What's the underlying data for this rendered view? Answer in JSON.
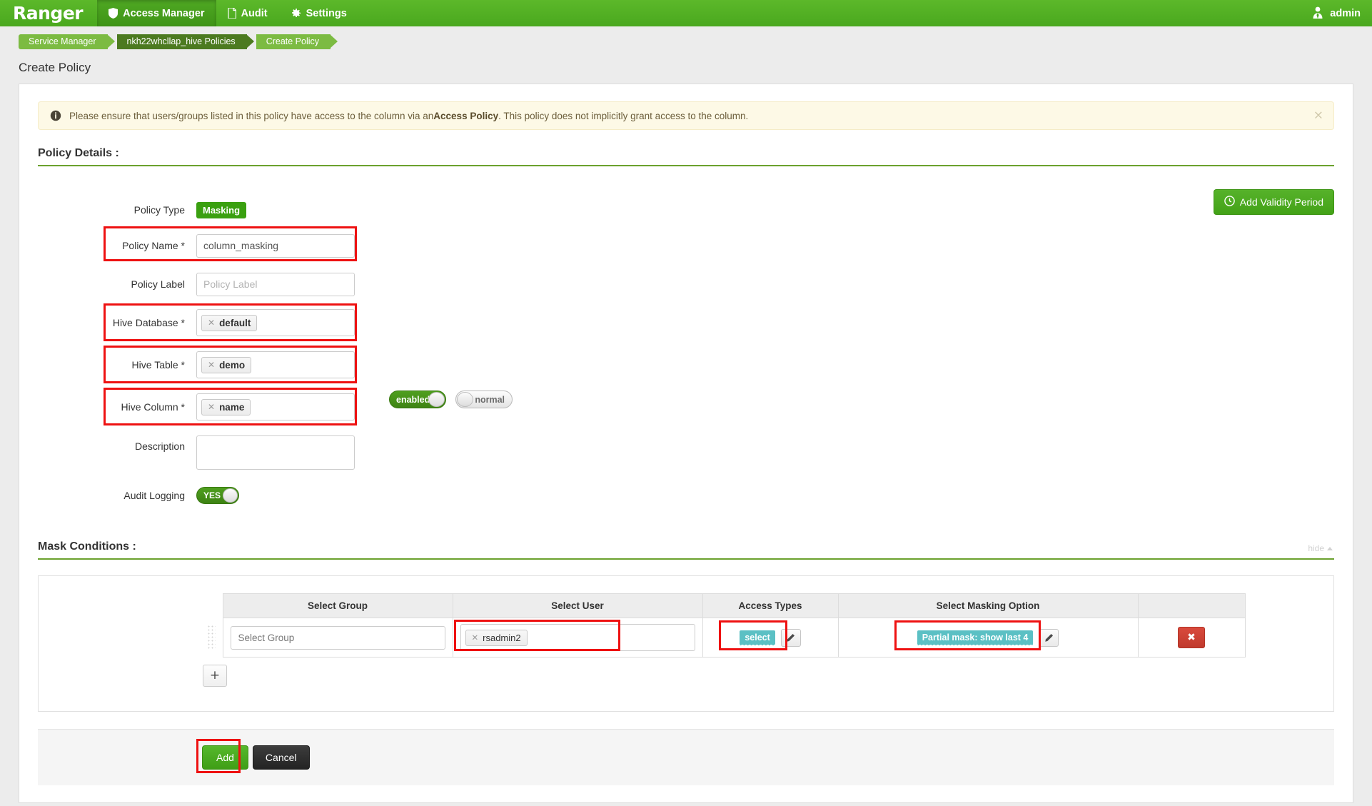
{
  "app": {
    "brand": "Ranger",
    "nav": [
      {
        "label": "Access Manager",
        "icon": "shield-icon",
        "active": true
      },
      {
        "label": "Audit",
        "icon": "file-icon",
        "active": false
      },
      {
        "label": "Settings",
        "icon": "gear-icon",
        "active": false
      }
    ],
    "user": {
      "name": "admin",
      "icon": "user-icon"
    }
  },
  "breadcrumb": [
    {
      "label": "Service Manager",
      "style": "light"
    },
    {
      "label": "nkh22whcllap_hive Policies",
      "style": "dark"
    },
    {
      "label": "Create Policy",
      "style": "light"
    }
  ],
  "page": {
    "title": "Create Policy"
  },
  "alert": {
    "icon": "info-icon",
    "text_before": "Please ensure that users/groups listed in this policy have access to the column via an ",
    "emphasis": "Access Policy",
    "text_after": ". This policy does not implicitly grant access to the column.",
    "close_label": "×"
  },
  "policy_details": {
    "section_title": "Policy Details :",
    "add_validity_label": "Add Validity Period",
    "add_validity_icon": "clock-icon",
    "fields": {
      "policy_type": {
        "label": "Policy Type",
        "value": "Masking"
      },
      "policy_name": {
        "label": "Policy Name *",
        "value": "column_masking",
        "highlighted": true
      },
      "policy_label": {
        "label": "Policy Label",
        "value": "",
        "placeholder": "Policy Label"
      },
      "hive_database": {
        "label": "Hive Database *",
        "token": "default",
        "highlighted": true
      },
      "hive_table": {
        "label": "Hive Table *",
        "token": "demo",
        "highlighted": true
      },
      "hive_column": {
        "label": "Hive Column *",
        "token": "name",
        "highlighted": true
      },
      "description": {
        "label": "Description",
        "value": ""
      },
      "audit_logging": {
        "label": "Audit Logging",
        "value": "YES"
      }
    },
    "toggles": {
      "status": {
        "label": "enabled",
        "on": true
      },
      "priority": {
        "label": "normal",
        "on": false
      }
    }
  },
  "mask_conditions": {
    "section_title": "Mask Conditions :",
    "hide_label": "hide",
    "hide_icon": "caret-up-icon",
    "columns": [
      "Select Group",
      "Select User",
      "Access Types",
      "Select Masking Option",
      ""
    ],
    "rows": [
      {
        "group_placeholder": "Select Group",
        "group_value": "",
        "user_token": "rsadmin2",
        "access_type": "select",
        "masking_option": "Partial mask: show last 4",
        "edit_icon": "pencil-icon",
        "delete_icon": "close-icon"
      }
    ],
    "add_row_label": "+"
  },
  "footer": {
    "add_label": "Add",
    "cancel_label": "Cancel"
  },
  "colors": {
    "brand_green": "#5cb82a",
    "breadcrumb_light": "#7cbb42",
    "breadcrumb_dark": "#4c7a20",
    "masking_badge": "#3aa010",
    "teal_tag": "#5bc0c4",
    "highlight_red": "#ee1111",
    "delete_red": "#d94a3d",
    "alert_bg": "#fdf9e6"
  }
}
